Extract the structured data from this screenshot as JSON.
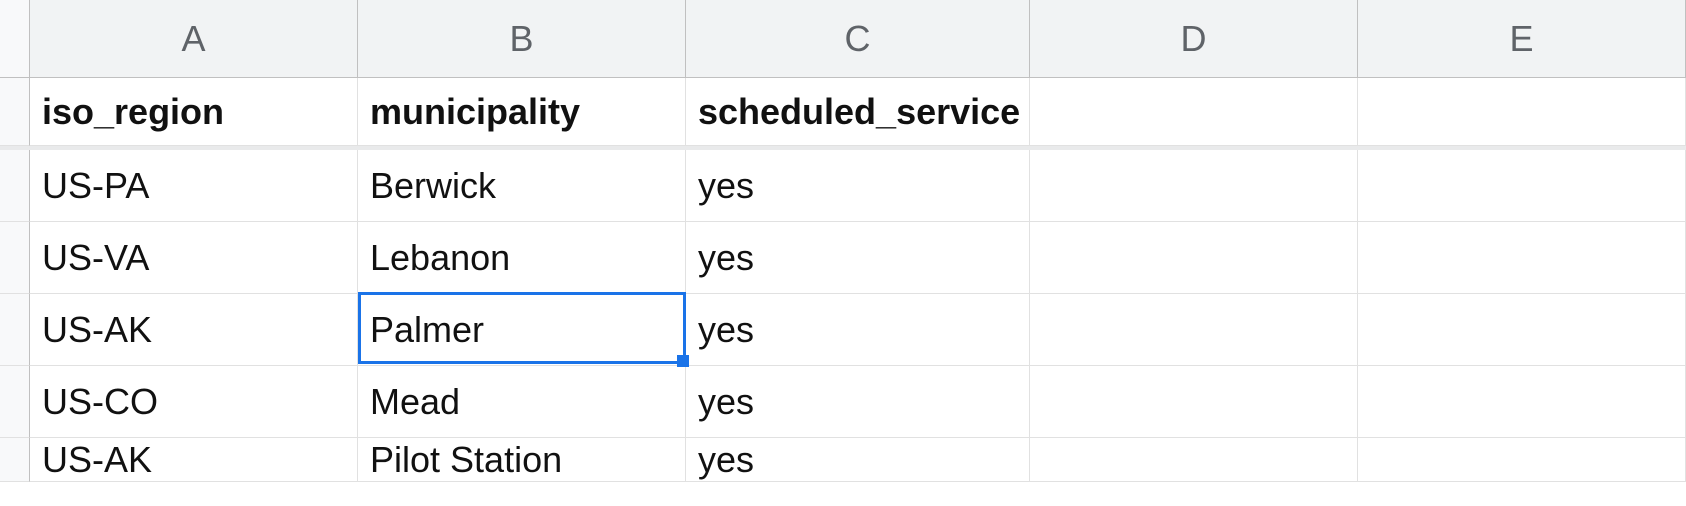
{
  "columns": [
    "A",
    "B",
    "C",
    "D",
    "E"
  ],
  "header_row": {
    "A": "iso_region",
    "B": "municipality",
    "C": "scheduled_service",
    "D": "",
    "E": ""
  },
  "rows": [
    {
      "A": "US-PA",
      "B": "Berwick",
      "C": "yes",
      "D": "",
      "E": ""
    },
    {
      "A": "US-VA",
      "B": "Lebanon",
      "C": "yes",
      "D": "",
      "E": ""
    },
    {
      "A": "US-AK",
      "B": "Palmer",
      "C": "yes",
      "D": "",
      "E": ""
    },
    {
      "A": "US-CO",
      "B": "Mead",
      "C": "yes",
      "D": "",
      "E": ""
    },
    {
      "A": "US-AK",
      "B": "Pilot Station",
      "C": "yes",
      "D": "",
      "E": ""
    }
  ],
  "selected_cell": {
    "row": 2,
    "col": "B"
  }
}
